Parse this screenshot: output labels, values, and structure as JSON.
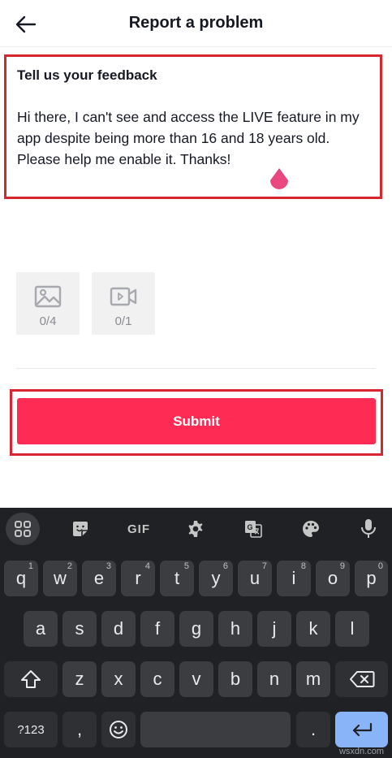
{
  "header": {
    "title": "Report a problem"
  },
  "feedback": {
    "heading": "Tell us your feedback",
    "text": "Hi there, I can't see and access the LIVE feature in my app despite being more than 16 and 18 years old. Please help me enable it. Thanks!"
  },
  "attachments": {
    "photo_count": "0/4",
    "video_count": "0/1"
  },
  "submit": {
    "label": "Submit"
  },
  "keyboard": {
    "toolbar": {
      "gif_label": "GIF"
    },
    "row1": [
      {
        "key": "q",
        "hint": "1"
      },
      {
        "key": "w",
        "hint": "2"
      },
      {
        "key": "e",
        "hint": "3"
      },
      {
        "key": "r",
        "hint": "4"
      },
      {
        "key": "t",
        "hint": "5"
      },
      {
        "key": "y",
        "hint": "6"
      },
      {
        "key": "u",
        "hint": "7"
      },
      {
        "key": "i",
        "hint": "8"
      },
      {
        "key": "o",
        "hint": "9"
      },
      {
        "key": "p",
        "hint": "0"
      }
    ],
    "row2": [
      "a",
      "s",
      "d",
      "f",
      "g",
      "h",
      "j",
      "k",
      "l"
    ],
    "row3": [
      "z",
      "x",
      "c",
      "v",
      "b",
      "n",
      "m"
    ],
    "row4": {
      "symbols": "?123",
      "comma": ",",
      "period": "."
    }
  },
  "watermark": "wsxdn.com",
  "colors": {
    "accent": "#fe2c55",
    "highlight_border": "#d7262f",
    "keyboard_bg": "#202124",
    "key_bg": "#3c3d40",
    "enter_key": "#8ab4f8"
  }
}
